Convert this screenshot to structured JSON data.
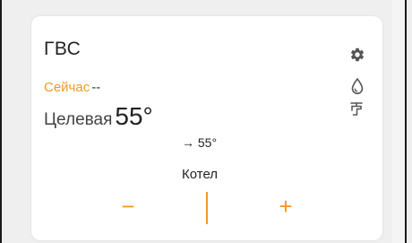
{
  "widget": {
    "title": "ГВС",
    "now_label": "Сейчас",
    "now_value": "--",
    "target_label": "Целевая",
    "target_value": "55°",
    "arrow_value": "→ 55°",
    "source": "Котел",
    "minus_label": "−",
    "plus_label": "+"
  },
  "icons": {
    "settings": "gear-icon",
    "water": "water-drop-icon",
    "tap": "tap-icon"
  },
  "colors": {
    "accent": "#f29a1f",
    "text": "#222222",
    "card_background": "#ffffff",
    "page_background": "#efefef"
  }
}
